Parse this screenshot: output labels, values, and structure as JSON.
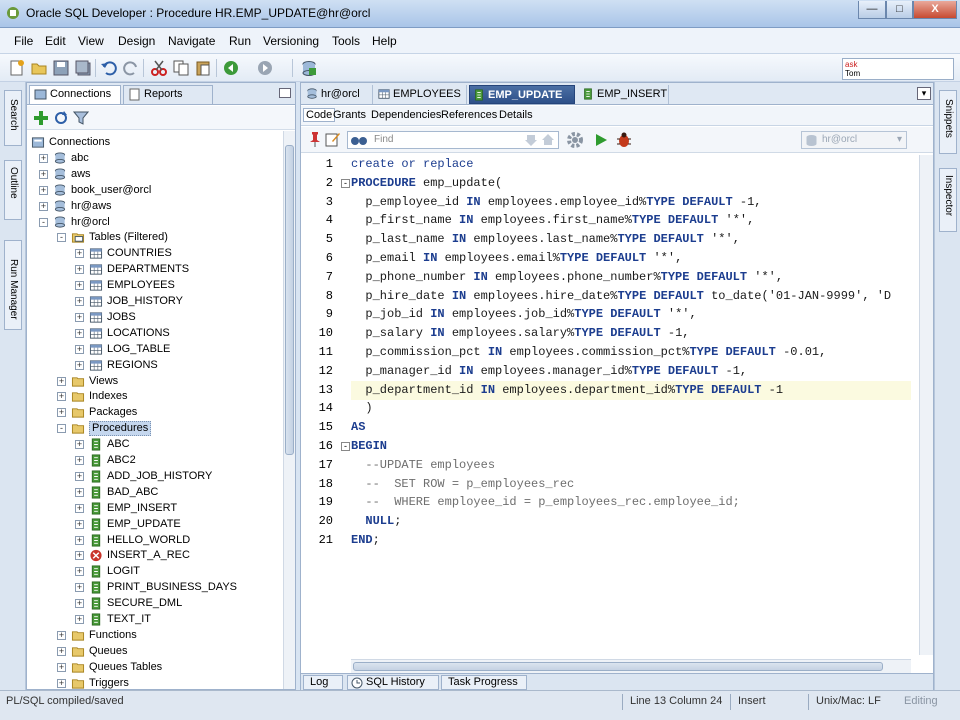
{
  "window": {
    "title": "Oracle SQL Developer : Procedure HR.EMP_UPDATE@hr@orcl",
    "min_label": "—",
    "max_label": "□",
    "close_label": "X"
  },
  "menu": [
    "File",
    "Edit",
    "View",
    "Design",
    "Navigate",
    "Run",
    "Versioning",
    "Tools",
    "Help"
  ],
  "toolbar": {
    "ask_line1": "ask",
    "ask_line2": "Tom"
  },
  "left_strip": [
    "Search",
    "Outline",
    "Run Manager"
  ],
  "right_strip": [
    "Snippets",
    "Inspector"
  ],
  "navigator": {
    "tabs": [
      "Connections",
      "Reports"
    ],
    "tree": [
      {
        "label": "Connections",
        "level": 0,
        "expander": "",
        "icon": "connections-icon"
      },
      {
        "label": "abc",
        "level": 1,
        "expander": "+",
        "icon": "database-icon"
      },
      {
        "label": "aws",
        "level": 1,
        "expander": "+",
        "icon": "database-icon"
      },
      {
        "label": "book_user@orcl",
        "level": 1,
        "expander": "+",
        "icon": "database-icon"
      },
      {
        "label": "hr@aws",
        "level": 1,
        "expander": "+",
        "icon": "database-icon"
      },
      {
        "label": "hr@orcl",
        "level": 1,
        "expander": "-",
        "icon": "database-icon"
      },
      {
        "label": "Tables (Filtered)",
        "level": 2,
        "expander": "-",
        "icon": "folder-table-icon"
      },
      {
        "label": "COUNTRIES",
        "level": 3,
        "expander": "+",
        "icon": "table-icon"
      },
      {
        "label": "DEPARTMENTS",
        "level": 3,
        "expander": "+",
        "icon": "table-icon"
      },
      {
        "label": "EMPLOYEES",
        "level": 3,
        "expander": "+",
        "icon": "table-icon"
      },
      {
        "label": "JOB_HISTORY",
        "level": 3,
        "expander": "+",
        "icon": "table-icon"
      },
      {
        "label": "JOBS",
        "level": 3,
        "expander": "+",
        "icon": "table-icon"
      },
      {
        "label": "LOCATIONS",
        "level": 3,
        "expander": "+",
        "icon": "table-icon"
      },
      {
        "label": "LOG_TABLE",
        "level": 3,
        "expander": "+",
        "icon": "table-icon"
      },
      {
        "label": "REGIONS",
        "level": 3,
        "expander": "+",
        "icon": "table-icon"
      },
      {
        "label": "Views",
        "level": 2,
        "expander": "+",
        "icon": "folder-icon"
      },
      {
        "label": "Indexes",
        "level": 2,
        "expander": "+",
        "icon": "folder-icon"
      },
      {
        "label": "Packages",
        "level": 2,
        "expander": "+",
        "icon": "folder-icon"
      },
      {
        "label": "Procedures",
        "level": 2,
        "expander": "-",
        "icon": "folder-icon",
        "selected": true
      },
      {
        "label": "ABC",
        "level": 3,
        "expander": "+",
        "icon": "procedure-icon"
      },
      {
        "label": "ABC2",
        "level": 3,
        "expander": "+",
        "icon": "procedure-icon"
      },
      {
        "label": "ADD_JOB_HISTORY",
        "level": 3,
        "expander": "+",
        "icon": "procedure-icon"
      },
      {
        "label": "BAD_ABC",
        "level": 3,
        "expander": "+",
        "icon": "procedure-icon"
      },
      {
        "label": "EMP_INSERT",
        "level": 3,
        "expander": "+",
        "icon": "procedure-icon"
      },
      {
        "label": "EMP_UPDATE",
        "level": 3,
        "expander": "+",
        "icon": "procedure-icon"
      },
      {
        "label": "HELLO_WORLD",
        "level": 3,
        "expander": "+",
        "icon": "procedure-icon"
      },
      {
        "label": "INSERT_A_REC",
        "level": 3,
        "expander": "+",
        "icon": "procedure-error-icon"
      },
      {
        "label": "LOGIT",
        "level": 3,
        "expander": "+",
        "icon": "procedure-icon"
      },
      {
        "label": "PRINT_BUSINESS_DAYS",
        "level": 3,
        "expander": "+",
        "icon": "procedure-icon"
      },
      {
        "label": "SECURE_DML",
        "level": 3,
        "expander": "+",
        "icon": "procedure-icon"
      },
      {
        "label": "TEXT_IT",
        "level": 3,
        "expander": "+",
        "icon": "procedure-icon"
      },
      {
        "label": "Functions",
        "level": 2,
        "expander": "+",
        "icon": "folder-icon"
      },
      {
        "label": "Queues",
        "level": 2,
        "expander": "+",
        "icon": "folder-icon"
      },
      {
        "label": "Queues Tables",
        "level": 2,
        "expander": "+",
        "icon": "folder-icon"
      },
      {
        "label": "Triggers",
        "level": 2,
        "expander": "+",
        "icon": "folder-icon"
      }
    ]
  },
  "editor": {
    "tabs": [
      "hr@orcl",
      "EMPLOYEES",
      "EMP_UPDATE",
      "EMP_INSERT"
    ],
    "active_tab": 2,
    "subtabs": [
      "Code",
      "Grants",
      "Dependencies",
      "References",
      "Details"
    ],
    "find_placeholder": "Find",
    "connection": "hr@orcl",
    "highlight_line": 13,
    "lines": [
      [
        [
          "kw2",
          "create or replace"
        ]
      ],
      [
        [
          "kw",
          "PROCEDURE"
        ],
        [
          "t",
          " emp_update("
        ]
      ],
      [
        [
          "t",
          "  p_employee_id "
        ],
        [
          "kw",
          "IN"
        ],
        [
          "t",
          " employees.employee_id%"
        ],
        [
          "kw",
          "TYPE DEFAULT"
        ],
        [
          "t",
          " -1,"
        ]
      ],
      [
        [
          "t",
          "  p_first_name "
        ],
        [
          "kw",
          "IN"
        ],
        [
          "t",
          " employees.first_name%"
        ],
        [
          "kw",
          "TYPE DEFAULT"
        ],
        [
          "t",
          " '*',"
        ]
      ],
      [
        [
          "t",
          "  p_last_name "
        ],
        [
          "kw",
          "IN"
        ],
        [
          "t",
          " employees.last_name%"
        ],
        [
          "kw",
          "TYPE DEFAULT"
        ],
        [
          "t",
          " '*',"
        ]
      ],
      [
        [
          "t",
          "  p_email "
        ],
        [
          "kw",
          "IN"
        ],
        [
          "t",
          " employees.email%"
        ],
        [
          "kw",
          "TYPE DEFAULT"
        ],
        [
          "t",
          " '*',"
        ]
      ],
      [
        [
          "t",
          "  p_phone_number "
        ],
        [
          "kw",
          "IN"
        ],
        [
          "t",
          " employees.phone_number%"
        ],
        [
          "kw",
          "TYPE DEFAULT"
        ],
        [
          "t",
          " '*',"
        ]
      ],
      [
        [
          "t",
          "  p_hire_date "
        ],
        [
          "kw",
          "IN"
        ],
        [
          "t",
          " employees.hire_date%"
        ],
        [
          "kw",
          "TYPE DEFAULT"
        ],
        [
          "t",
          " to_date('01-JAN-9999', 'D"
        ]
      ],
      [
        [
          "t",
          "  p_job_id "
        ],
        [
          "kw",
          "IN"
        ],
        [
          "t",
          " employees.job_id%"
        ],
        [
          "kw",
          "TYPE DEFAULT"
        ],
        [
          "t",
          " '*',"
        ]
      ],
      [
        [
          "t",
          "  p_salary "
        ],
        [
          "kw",
          "IN"
        ],
        [
          "t",
          " employees.salary%"
        ],
        [
          "kw",
          "TYPE DEFAULT"
        ],
        [
          "t",
          " -1,"
        ]
      ],
      [
        [
          "t",
          "  p_commission_pct "
        ],
        [
          "kw",
          "IN"
        ],
        [
          "t",
          " employees.commission_pct%"
        ],
        [
          "kw",
          "TYPE DEFAULT"
        ],
        [
          "t",
          " -0.01,"
        ]
      ],
      [
        [
          "t",
          "  p_manager_id "
        ],
        [
          "kw",
          "IN"
        ],
        [
          "t",
          " employees.manager_id%"
        ],
        [
          "kw",
          "TYPE DEFAULT"
        ],
        [
          "t",
          " -1,"
        ]
      ],
      [
        [
          "t",
          "  p_department_id "
        ],
        [
          "kw",
          "IN"
        ],
        [
          "t",
          " employees.department_id%"
        ],
        [
          "kw",
          "TYPE DEFAULT"
        ],
        [
          "t",
          " -1"
        ]
      ],
      [
        [
          "t",
          "  )"
        ]
      ],
      [
        [
          "kw",
          "AS"
        ]
      ],
      [
        [
          "kw",
          "BEGIN"
        ]
      ],
      [
        [
          "cm",
          "  --UPDATE employees"
        ]
      ],
      [
        [
          "cm",
          "  --  SET ROW = p_employees_rec"
        ]
      ],
      [
        [
          "cm",
          "  --  WHERE employee_id = p_employees_rec.employee_id;"
        ]
      ],
      [
        [
          "t",
          "  "
        ],
        [
          "kw",
          "NULL"
        ],
        [
          "t",
          ";"
        ]
      ],
      [
        [
          "kw",
          "END"
        ],
        [
          "t",
          ";"
        ]
      ]
    ],
    "bottom_tabs": [
      "Log",
      "SQL History",
      "Task Progress"
    ]
  },
  "status": {
    "message": "PL/SQL compiled/saved",
    "position": "Line 13 Column 24",
    "mode": "Insert",
    "line_endings": "Unix/Mac: LF",
    "state": "Editing"
  }
}
